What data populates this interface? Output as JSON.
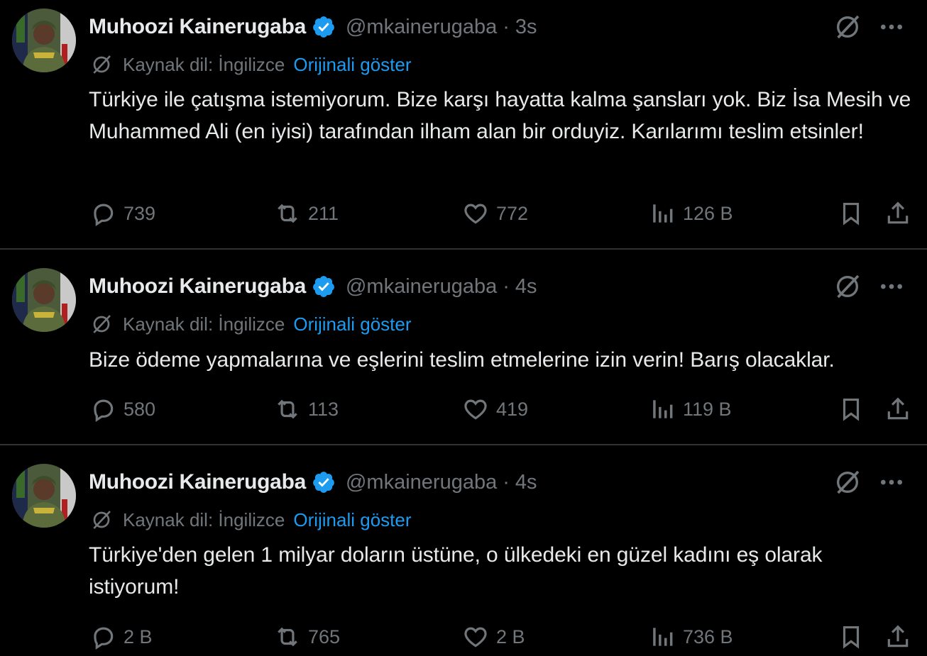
{
  "tweets": [
    {
      "author": "Muhoozi Kainerugaba",
      "handle": "@mkainerugaba",
      "time": "3s",
      "source_lang": "Kaynak dil: İngilizce",
      "show_original": "Orijinali göster",
      "text": "Türkiye ile çatışma istemiyorum. Bize karşı hayatta kalma şansları yok. Biz İsa Mesih ve Muhammed Ali (en iyisi) tarafından ilham alan bir orduyiz. Karılarımı teslim etsinler!",
      "replies": "739",
      "retweets": "211",
      "likes": "772",
      "views": "126 B"
    },
    {
      "author": "Muhoozi Kainerugaba",
      "handle": "@mkainerugaba",
      "time": "4s",
      "source_lang": "Kaynak dil: İngilizce",
      "show_original": "Orijinali göster",
      "text": "Bize ödeme yapmalarına ve eşlerini teslim etmelerine izin verin! Barış olacaklar.",
      "replies": "580",
      "retweets": "113",
      "likes": "419",
      "views": "119 B"
    },
    {
      "author": "Muhoozi Kainerugaba",
      "handle": "@mkainerugaba",
      "time": "4s",
      "source_lang": "Kaynak dil: İngilizce",
      "show_original": "Orijinali göster",
      "text": "Türkiye'den gelen 1 milyar doların üstüne, o ülkedeki en güzel kadını eş olarak istiyorum!",
      "replies": "2 B",
      "retweets": "765",
      "likes": "2 B",
      "views": "736 B"
    }
  ],
  "icons": {
    "verified": "verified-badge-icon",
    "grok": "grok-icon",
    "more": "more-icon",
    "translate": "translate-icon",
    "reply": "reply-icon",
    "retweet": "retweet-icon",
    "like": "heart-icon",
    "views": "views-icon",
    "bookmark": "bookmark-icon",
    "share": "share-icon"
  },
  "colors": {
    "background": "#000000",
    "text": "#e7e9ea",
    "muted": "#71767b",
    "accent": "#1d9bf0",
    "divider": "#2f3336"
  }
}
